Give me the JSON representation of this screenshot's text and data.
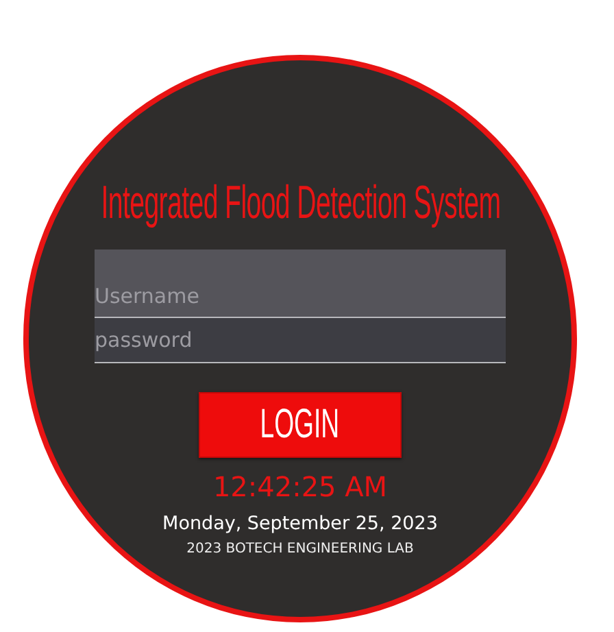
{
  "title": "Integrated Flood Detection System",
  "username": {
    "placeholder": "Username"
  },
  "password": {
    "placeholder": "password"
  },
  "login_button": "LOGIN",
  "clock": "12:42:25 AM",
  "date": "Monday, September 25, 2023",
  "footer": "2023 BOTECH ENGINEERING LAB"
}
